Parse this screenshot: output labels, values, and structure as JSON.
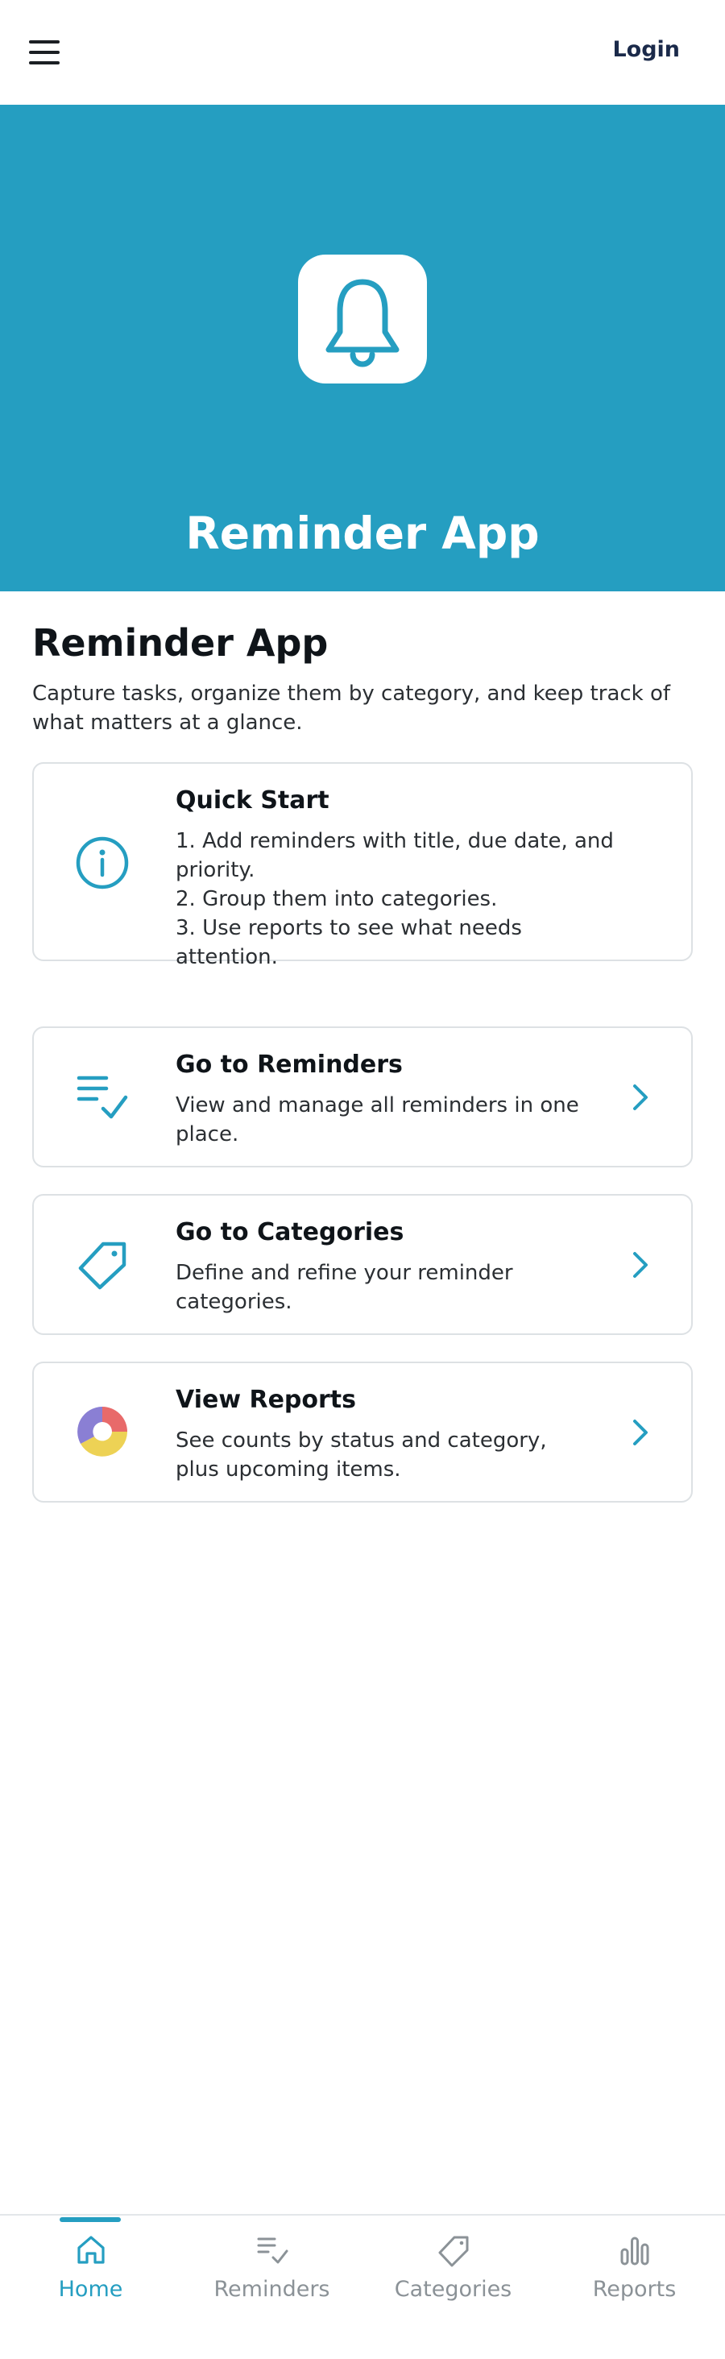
{
  "header": {
    "login_label": "Login"
  },
  "hero": {
    "title": "Reminder App",
    "icon": "bell-icon"
  },
  "intro": {
    "title": "Reminder App",
    "description": "Capture tasks, organize them by category, and keep track of what matters at a glance."
  },
  "quick_start": {
    "icon": "info-icon",
    "title": "Quick Start",
    "steps": [
      "1. Add reminders with title, due date, and priority.",
      "2. Group them into categories.",
      "3. Use reports to see what needs attention."
    ]
  },
  "nav_cards": [
    {
      "icon": "checklist-icon",
      "title": "Go to Reminders",
      "text": "View and manage all reminders in one place."
    },
    {
      "icon": "tag-icon",
      "title": "Go to Categories",
      "text": "Define and refine your reminder categories."
    },
    {
      "icon": "donut-chart-icon",
      "title": "View Reports",
      "text": "See counts by status and category, plus upcoming items."
    }
  ],
  "bottom_nav": {
    "items": [
      {
        "label": "Home",
        "icon": "home-icon",
        "active": true
      },
      {
        "label": "Reminders",
        "icon": "list-check-icon",
        "active": false
      },
      {
        "label": "Categories",
        "icon": "tag-icon",
        "active": false
      },
      {
        "label": "Reports",
        "icon": "bar-chart-icon",
        "active": false
      }
    ]
  },
  "colors": {
    "accent": "#259ec1",
    "text": "#1b1f23",
    "muted": "#8b9297",
    "border": "#dde1e4"
  }
}
